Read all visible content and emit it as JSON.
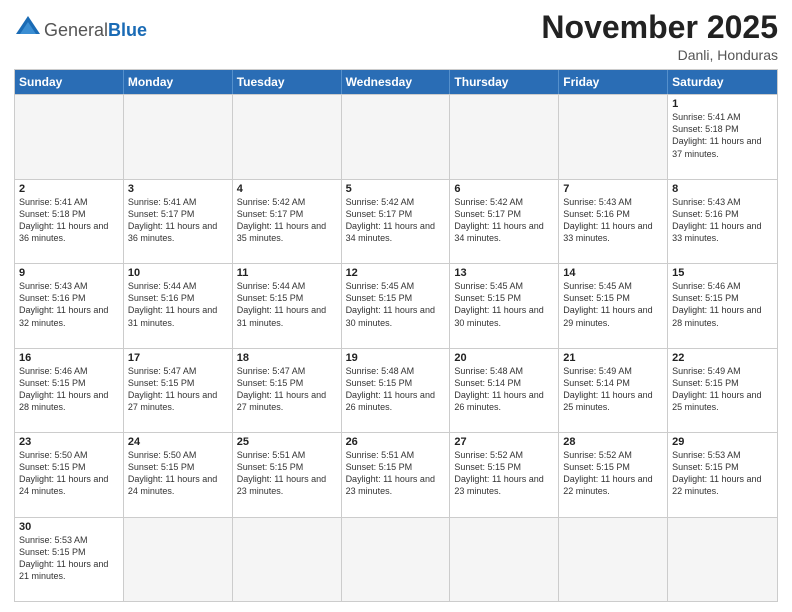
{
  "logo": {
    "text_general": "General",
    "text_blue": "Blue"
  },
  "title": "November 2025",
  "location": "Danli, Honduras",
  "header_days": [
    "Sunday",
    "Monday",
    "Tuesday",
    "Wednesday",
    "Thursday",
    "Friday",
    "Saturday"
  ],
  "weeks": [
    [
      {
        "day": "",
        "info": ""
      },
      {
        "day": "",
        "info": ""
      },
      {
        "day": "",
        "info": ""
      },
      {
        "day": "",
        "info": ""
      },
      {
        "day": "",
        "info": ""
      },
      {
        "day": "",
        "info": ""
      },
      {
        "day": "1",
        "info": "Sunrise: 5:41 AM\nSunset: 5:18 PM\nDaylight: 11 hours and 37 minutes."
      }
    ],
    [
      {
        "day": "2",
        "info": "Sunrise: 5:41 AM\nSunset: 5:18 PM\nDaylight: 11 hours and 36 minutes."
      },
      {
        "day": "3",
        "info": "Sunrise: 5:41 AM\nSunset: 5:17 PM\nDaylight: 11 hours and 36 minutes."
      },
      {
        "day": "4",
        "info": "Sunrise: 5:42 AM\nSunset: 5:17 PM\nDaylight: 11 hours and 35 minutes."
      },
      {
        "day": "5",
        "info": "Sunrise: 5:42 AM\nSunset: 5:17 PM\nDaylight: 11 hours and 34 minutes."
      },
      {
        "day": "6",
        "info": "Sunrise: 5:42 AM\nSunset: 5:17 PM\nDaylight: 11 hours and 34 minutes."
      },
      {
        "day": "7",
        "info": "Sunrise: 5:43 AM\nSunset: 5:16 PM\nDaylight: 11 hours and 33 minutes."
      },
      {
        "day": "8",
        "info": "Sunrise: 5:43 AM\nSunset: 5:16 PM\nDaylight: 11 hours and 33 minutes."
      }
    ],
    [
      {
        "day": "9",
        "info": "Sunrise: 5:43 AM\nSunset: 5:16 PM\nDaylight: 11 hours and 32 minutes."
      },
      {
        "day": "10",
        "info": "Sunrise: 5:44 AM\nSunset: 5:16 PM\nDaylight: 11 hours and 31 minutes."
      },
      {
        "day": "11",
        "info": "Sunrise: 5:44 AM\nSunset: 5:15 PM\nDaylight: 11 hours and 31 minutes."
      },
      {
        "day": "12",
        "info": "Sunrise: 5:45 AM\nSunset: 5:15 PM\nDaylight: 11 hours and 30 minutes."
      },
      {
        "day": "13",
        "info": "Sunrise: 5:45 AM\nSunset: 5:15 PM\nDaylight: 11 hours and 30 minutes."
      },
      {
        "day": "14",
        "info": "Sunrise: 5:45 AM\nSunset: 5:15 PM\nDaylight: 11 hours and 29 minutes."
      },
      {
        "day": "15",
        "info": "Sunrise: 5:46 AM\nSunset: 5:15 PM\nDaylight: 11 hours and 28 minutes."
      }
    ],
    [
      {
        "day": "16",
        "info": "Sunrise: 5:46 AM\nSunset: 5:15 PM\nDaylight: 11 hours and 28 minutes."
      },
      {
        "day": "17",
        "info": "Sunrise: 5:47 AM\nSunset: 5:15 PM\nDaylight: 11 hours and 27 minutes."
      },
      {
        "day": "18",
        "info": "Sunrise: 5:47 AM\nSunset: 5:15 PM\nDaylight: 11 hours and 27 minutes."
      },
      {
        "day": "19",
        "info": "Sunrise: 5:48 AM\nSunset: 5:15 PM\nDaylight: 11 hours and 26 minutes."
      },
      {
        "day": "20",
        "info": "Sunrise: 5:48 AM\nSunset: 5:14 PM\nDaylight: 11 hours and 26 minutes."
      },
      {
        "day": "21",
        "info": "Sunrise: 5:49 AM\nSunset: 5:14 PM\nDaylight: 11 hours and 25 minutes."
      },
      {
        "day": "22",
        "info": "Sunrise: 5:49 AM\nSunset: 5:15 PM\nDaylight: 11 hours and 25 minutes."
      }
    ],
    [
      {
        "day": "23",
        "info": "Sunrise: 5:50 AM\nSunset: 5:15 PM\nDaylight: 11 hours and 24 minutes."
      },
      {
        "day": "24",
        "info": "Sunrise: 5:50 AM\nSunset: 5:15 PM\nDaylight: 11 hours and 24 minutes."
      },
      {
        "day": "25",
        "info": "Sunrise: 5:51 AM\nSunset: 5:15 PM\nDaylight: 11 hours and 23 minutes."
      },
      {
        "day": "26",
        "info": "Sunrise: 5:51 AM\nSunset: 5:15 PM\nDaylight: 11 hours and 23 minutes."
      },
      {
        "day": "27",
        "info": "Sunrise: 5:52 AM\nSunset: 5:15 PM\nDaylight: 11 hours and 23 minutes."
      },
      {
        "day": "28",
        "info": "Sunrise: 5:52 AM\nSunset: 5:15 PM\nDaylight: 11 hours and 22 minutes."
      },
      {
        "day": "29",
        "info": "Sunrise: 5:53 AM\nSunset: 5:15 PM\nDaylight: 11 hours and 22 minutes."
      }
    ],
    [
      {
        "day": "30",
        "info": "Sunrise: 5:53 AM\nSunset: 5:15 PM\nDaylight: 11 hours and 21 minutes."
      },
      {
        "day": "",
        "info": ""
      },
      {
        "day": "",
        "info": ""
      },
      {
        "day": "",
        "info": ""
      },
      {
        "day": "",
        "info": ""
      },
      {
        "day": "",
        "info": ""
      },
      {
        "day": "",
        "info": ""
      }
    ]
  ]
}
